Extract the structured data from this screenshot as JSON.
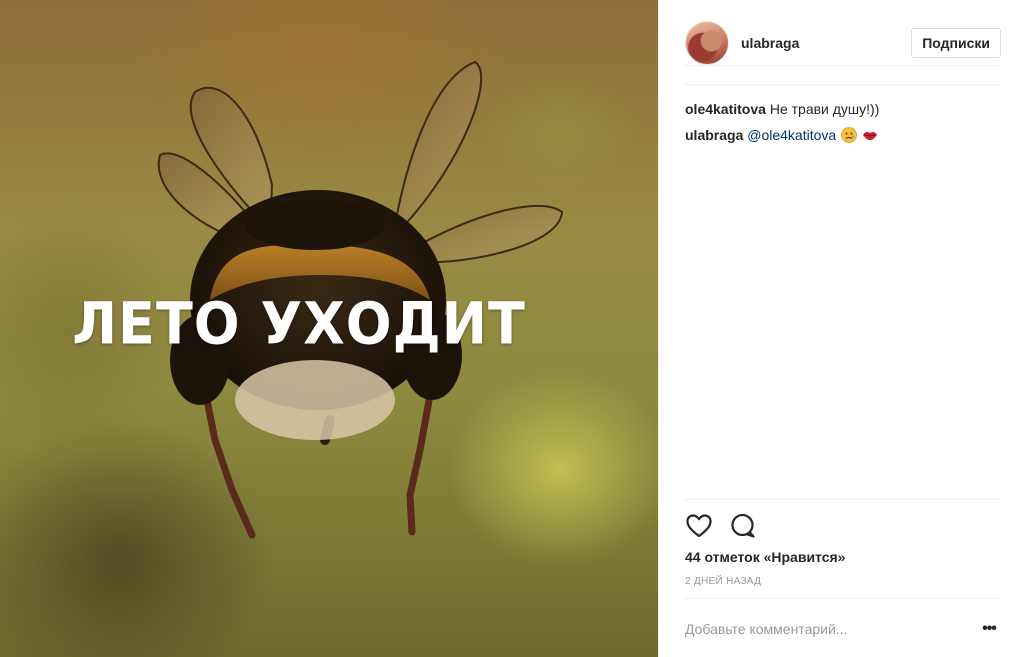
{
  "photo": {
    "caption": "ЛЕТО УХОДИТ",
    "subject": "bee"
  },
  "post": {
    "username": "ulabraga",
    "follow_label": "Подписки"
  },
  "comments": [
    {
      "author": "ole4katitova",
      "text": "Не трави душу!))",
      "mention": "",
      "emojis": []
    },
    {
      "author": "ulabraga",
      "text": "",
      "mention": "@ole4katitova",
      "emojis": [
        "disappointed-face-icon",
        "lips-icon"
      ]
    }
  ],
  "stats": {
    "likes": "44 отметок «Нравится»",
    "time": "2 дней назад"
  },
  "comment_box": {
    "placeholder": "Добавьте комментарий..."
  },
  "colors": {
    "link": "#003569",
    "muted": "#999999",
    "border": "#efefef"
  }
}
